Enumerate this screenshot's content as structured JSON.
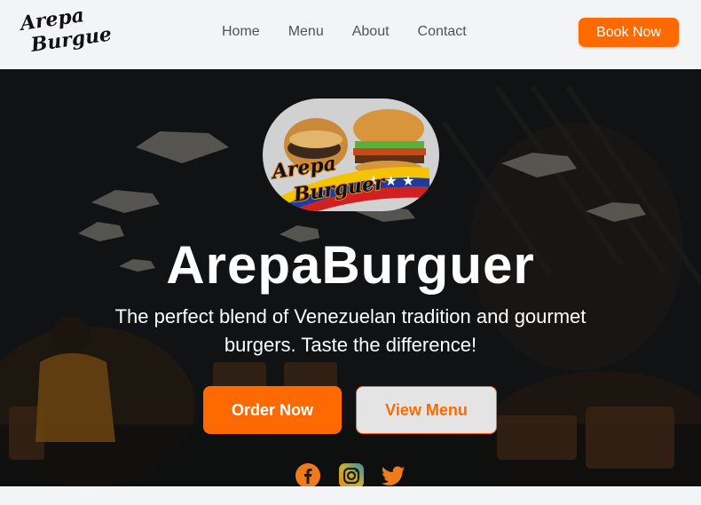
{
  "header": {
    "logo_line1": "Arepa",
    "logo_line2": "Burguer",
    "nav": [
      {
        "label": "Home"
      },
      {
        "label": "Menu"
      },
      {
        "label": "About"
      },
      {
        "label": "Contact"
      }
    ],
    "book_label": "Book Now"
  },
  "hero": {
    "logo_line1": "Arepa",
    "logo_line2": "Burguer",
    "title": "ArepaBurguer",
    "subtitle": "The perfect blend of Venezuelan tradition and gourmet burgers. Taste the difference!",
    "order_label": "Order Now",
    "menu_label": "View Menu",
    "social": [
      {
        "icon": "facebook-icon"
      },
      {
        "icon": "instagram-icon"
      },
      {
        "icon": "twitter-icon"
      }
    ]
  },
  "colors": {
    "accent": "#ff6a00",
    "header_bg": "#f3f4f6",
    "nav_text": "#4b5563"
  }
}
